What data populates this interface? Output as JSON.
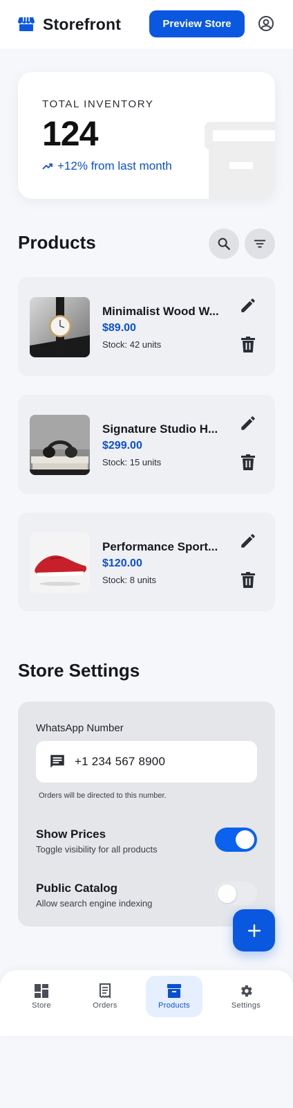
{
  "header": {
    "brand": "Storefront",
    "brand_icon": "storefront-icon",
    "preview_button": "Preview Store",
    "account_icon": "account-circle-icon"
  },
  "inventory": {
    "label": "TOTAL INVENTORY",
    "value": "124",
    "trend": "+12% from last month",
    "trend_icon": "trending-up-icon"
  },
  "products_section": {
    "title": "Products",
    "search_icon": "search-icon",
    "filter_icon": "filter-icon",
    "items": [
      {
        "name": "Minimalist Wood W...",
        "price": "$89.00",
        "stock": "Stock: 42 units",
        "image": "watch"
      },
      {
        "name": "Signature Studio H...",
        "price": "$299.00",
        "stock": "Stock: 15 units",
        "image": "headphones"
      },
      {
        "name": "Performance Sport...",
        "price": "$120.00",
        "stock": "Stock: 8 units",
        "image": "sneaker"
      }
    ]
  },
  "settings": {
    "title": "Store Settings",
    "whatsapp_label": "WhatsApp Number",
    "whatsapp_value": "+1 234 567 8900",
    "whatsapp_hint": "Orders will be directed to this number.",
    "show_prices": {
      "title": "Show Prices",
      "subtitle": "Toggle visibility for all products",
      "on": true
    },
    "public_catalog": {
      "title": "Public Catalog",
      "subtitle": "Allow search engine indexing",
      "on": false
    }
  },
  "fab_icon": "add-icon",
  "nav": [
    {
      "label": "Store",
      "icon": "dashboard-icon",
      "active": false
    },
    {
      "label": "Orders",
      "icon": "receipt-icon",
      "active": false
    },
    {
      "label": "Products",
      "icon": "inventory-box-icon",
      "active": true
    },
    {
      "label": "Settings",
      "icon": "gear-icon",
      "active": false
    }
  ],
  "colors": {
    "primary": "#0a58e0",
    "accent_text": "#0b4fd1",
    "card": "#eef0f4",
    "background": "#f5f7fb"
  }
}
